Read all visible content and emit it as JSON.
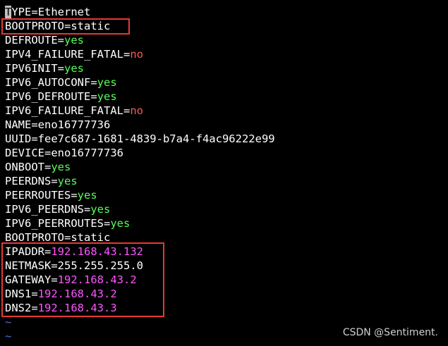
{
  "editor": {
    "lines": [
      {
        "key": "TYPE",
        "value": "Ethernet",
        "style": "plain"
      },
      {
        "key": "BOOTPROTO",
        "value": "static",
        "style": "plain"
      },
      {
        "key": "DEFROUTE",
        "value": "yes",
        "style": "yes"
      },
      {
        "key": "IPV4_FAILURE_FATAL",
        "value": "no",
        "style": "no"
      },
      {
        "key": "IPV6INIT",
        "value": "yes",
        "style": "yes"
      },
      {
        "key": "IPV6_AUTOCONF",
        "value": "yes",
        "style": "yes"
      },
      {
        "key": "IPV6_DEFROUTE",
        "value": "yes",
        "style": "yes"
      },
      {
        "key": "IPV6_FAILURE_FATAL",
        "value": "no",
        "style": "no"
      },
      {
        "key": "NAME",
        "value": "eno16777736",
        "style": "plain"
      },
      {
        "key": "UUID",
        "value": "fee7c687-1681-4839-b7a4-f4ac96222e99",
        "style": "plain"
      },
      {
        "key": "DEVICE",
        "value": "eno16777736",
        "style": "plain"
      },
      {
        "key": "ONBOOT",
        "value": "yes",
        "style": "yes"
      },
      {
        "key": "PEERDNS",
        "value": "yes",
        "style": "yes"
      },
      {
        "key": "PEERROUTES",
        "value": "yes",
        "style": "yes"
      },
      {
        "key": "IPV6_PEERDNS",
        "value": "yes",
        "style": "yes"
      },
      {
        "key": "IPV6_PEERROUTES",
        "value": "yes",
        "style": "yes"
      },
      {
        "key": "BOOTPROTO",
        "value": "static",
        "style": "plain"
      },
      {
        "key": "IPADDR",
        "value": "192.168.43.132",
        "style": "ip"
      },
      {
        "key": "NETMASK",
        "value": "255.255.255.0",
        "style": "plain"
      },
      {
        "key": "GATEWAY",
        "value": "192.168.43.2",
        "style": "ip"
      },
      {
        "key": "DNS1",
        "value": "192.168.43.2",
        "style": "ip"
      },
      {
        "key": "DNS2",
        "value": "192.168.43.3",
        "style": "ip"
      }
    ],
    "separator": "=",
    "empty_line_marker": "~",
    "empty_line_count": 2
  },
  "colors": {
    "background": "#000000",
    "text": "#ffffff",
    "yes": "#55ff55",
    "no": "#ff5555",
    "ip": "#ff55ff",
    "tilde": "#5c6bd6",
    "highlight_box": "#e53935"
  },
  "watermark": {
    "text": "CSDN @Sentiment."
  }
}
